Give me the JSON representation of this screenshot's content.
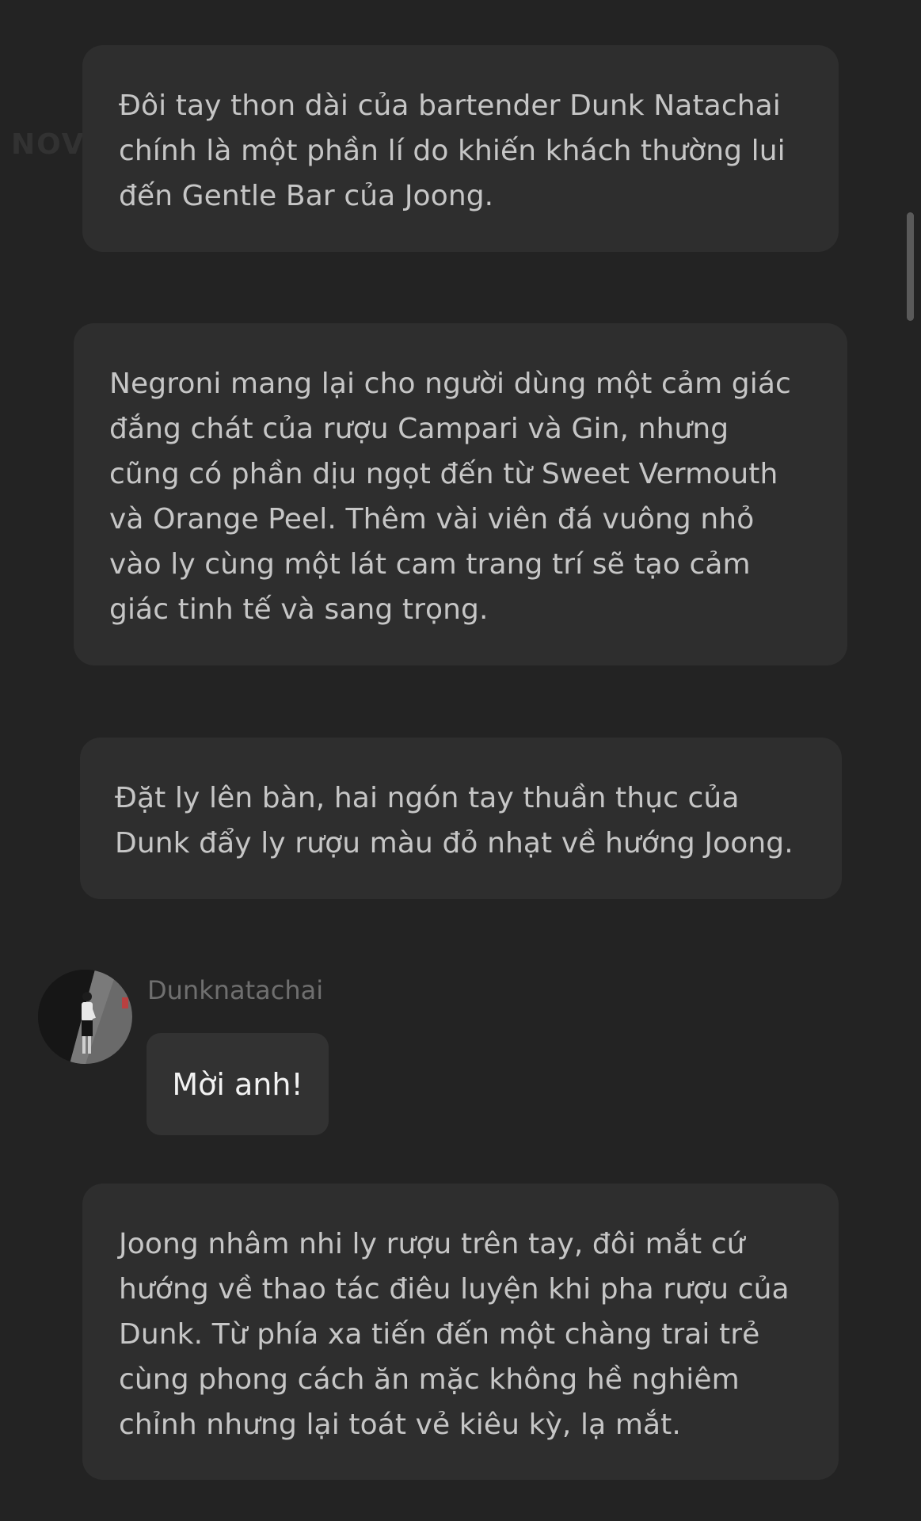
{
  "watermark": "NOVELTOON",
  "cards": [
    {
      "lines": [
        "Đôi tay thon dài của bartender Dunk Natachai",
        "chính là một phần lí do khiến khách thường lui",
        "đến Gentle Bar của Joong."
      ]
    },
    {
      "lines": [
        "Negroni mang lại cho người dùng một cảm giác",
        "đắng chát của rượu Campari và Gin, nhưng",
        "cũng có phần dịu ngọt đến từ Sweet Vermouth",
        "và Orange Peel. Thêm vài viên đá vuông nhỏ",
        "vào ly cùng một lát cam trang trí sẽ tạo cảm",
        "giác tinh tế và sang trọng."
      ]
    },
    {
      "lines": [
        "Đặt ly lên bàn, hai ngón tay thuần thục của",
        "Dunk đẩy ly rượu màu đỏ nhạt về hướng Joong."
      ]
    },
    {
      "lines": [
        "Joong nhâm nhi ly rượu trên tay, đôi mắt cứ",
        "hướng về thao tác điêu luyện khi pha rượu của",
        "Dunk. Từ phía xa tiến đến một chàng trai trẻ",
        "cùng phong cách ăn mặc không hề nghiêm",
        "chỉnh nhưng lại toát vẻ kiêu kỳ, lạ mắt."
      ]
    }
  ],
  "message": {
    "sender": "Dunknatachai",
    "text": "Mời anh!",
    "avatar_icon": "person-photo-avatar"
  },
  "colors": {
    "background": "#232323",
    "card": "#2e2e2e",
    "bubble": "#323232",
    "text": "#c6c6c6",
    "sender": "#6f6f6f"
  }
}
